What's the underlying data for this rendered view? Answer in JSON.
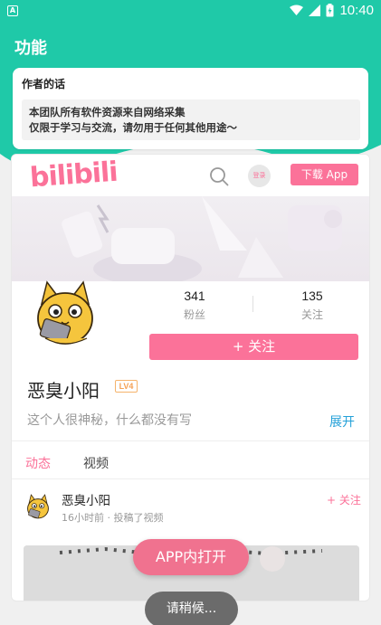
{
  "status_bar": {
    "app_badge": "A",
    "time": "10:40"
  },
  "app_bar": {
    "title": "功能"
  },
  "author_card": {
    "title": "作者的话",
    "line1": "本团队所有软件资源来自网络采集",
    "line2": "仅限于学习与交流，请勿用于任何其他用途～"
  },
  "bili": {
    "logo": "bilibili",
    "login": "登录",
    "download": "下载 App",
    "stats": [
      {
        "value": "341",
        "label": "粉丝"
      },
      {
        "value": "135",
        "label": "关注"
      }
    ],
    "follow_button": "+ 关注",
    "username": "恶臭小阳",
    "level": "LV4",
    "bio": "这个人很神秘，什么都没有写",
    "expand": "展开",
    "tabs": [
      {
        "label": "动态"
      },
      {
        "label": "视频"
      }
    ],
    "post": {
      "author": "恶臭小阳",
      "meta": "16小时前 · 投稿了视频",
      "follow": "+ 关注"
    },
    "open_app": "APP内打开"
  },
  "toast": "请稍候..."
}
